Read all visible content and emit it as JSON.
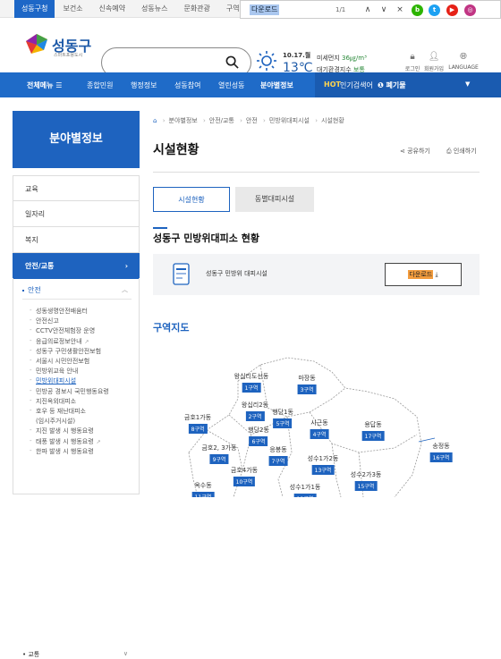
{
  "topbar": {
    "tabs": [
      "성동구청",
      "보건소",
      "신속예약",
      "성동뉴스",
      "문화관광",
      "구역"
    ],
    "find": {
      "query": "다운로드",
      "count": "1/1",
      "up": "∧",
      "down": "∨",
      "close": "×"
    },
    "sns": [
      {
        "label": "b",
        "color": "#2db400"
      },
      {
        "label": "t",
        "color": "#1da1f2"
      },
      {
        "label": "▶",
        "color": "#e62117"
      },
      {
        "label": "◎",
        "color": "#c13584"
      }
    ]
  },
  "header": {
    "logo_text": "성동구",
    "logo_sub": "스마트포용도시",
    "date": "10.17.월",
    "temp": "13℃",
    "air1_label": "미세먼지",
    "air1_value": "36㎍/m³",
    "air2_label": "대기환경지수",
    "air2_value": "보통",
    "utils": [
      {
        "icon": "lock-icon",
        "label": "로그인"
      },
      {
        "icon": "user-icon",
        "label": "회원가입"
      },
      {
        "icon": "globe-icon",
        "label": "LANGUAGE"
      }
    ]
  },
  "nav": {
    "items": [
      "전체메뉴 ☰",
      "종합민원",
      "행정정보",
      "성동참여",
      "열린성동",
      "분야별정보"
    ],
    "hot_label": "HOT",
    "hot_text": "인기검색어",
    "hot_item": "❶ 폐기물",
    "hot_arrow": "▼"
  },
  "left": {
    "title": "분야별정보",
    "menus": [
      "교육",
      "일자리",
      "복지",
      "안전/교통"
    ],
    "menu_arrow": "›",
    "sub_title": "안전",
    "sub_up": "︿",
    "sub_items": [
      {
        "label": "성동생명안전배움터",
        "ext": ""
      },
      {
        "label": "안전신고",
        "ext": ""
      },
      {
        "label": "CCTV안전체험장 운영",
        "ext": ""
      },
      {
        "label": "응급의료정보안내",
        "ext": "↗"
      },
      {
        "label": "성동구 구민생활안전보험",
        "ext": ""
      },
      {
        "label": "서울시 시민안전보험",
        "ext": ""
      },
      {
        "label": "민방위교육 안내",
        "ext": ""
      },
      {
        "label": "민방위대피시설",
        "ext": ""
      },
      {
        "label": "민방공 경보시 국민행동요령",
        "ext": ""
      },
      {
        "label": "지진옥외대피소",
        "ext": ""
      },
      {
        "label": "호우 등 재난대피소",
        "ext": ""
      },
      {
        "label": "(임시주거시설)",
        "ext": ""
      },
      {
        "label": "지진 발생 시 행동요령",
        "ext": ""
      },
      {
        "label": "태풍 발생 시 행동요령",
        "ext": "↗"
      },
      {
        "label": "한파 발생 시 행동요령",
        "ext": ""
      }
    ],
    "bottom": "교통",
    "bottom_icon": "∨"
  },
  "main": {
    "breadcrumb": [
      "⌂",
      "분야별정보",
      "안전/교통",
      "안전",
      "민방위대피시설",
      "시설현황"
    ],
    "title": "시설현황",
    "share": "공유하기",
    "print": "인쇄하기",
    "tabs": [
      "시설현황",
      "동별대피시설"
    ],
    "section_title": "성동구 민방위대피소 현황",
    "file_name": "성동구 민방위 대피시설",
    "download": "다운로드",
    "download_icon": "⤓",
    "map_title": "구역지도",
    "districts": [
      {
        "name": "왕십리도선동",
        "count": "1구역"
      },
      {
        "name": "마장동",
        "count": "3구역"
      },
      {
        "name": "왕십리2동",
        "count": "2구역"
      },
      {
        "name": "행당1동",
        "count": "5구역"
      },
      {
        "name": "금호1가동",
        "count": "8구역"
      },
      {
        "name": "사근동",
        "count": "4구역"
      },
      {
        "name": "용답동",
        "count": "17구역"
      },
      {
        "name": "행당2동",
        "count": "6구역"
      },
      {
        "name": "금호2, 3가동",
        "count": "9구역"
      },
      {
        "name": "응봉동",
        "count": "7구역"
      },
      {
        "name": "송정동",
        "count": "16구역"
      },
      {
        "name": "성수1가2동",
        "count": "13구역"
      },
      {
        "name": "금호4가동",
        "count": "10구역"
      },
      {
        "name": "옥수동",
        "count": "11구역"
      },
      {
        "name": "성수1가1동",
        "count": "12구역"
      },
      {
        "name": "성수2가3동",
        "count": "15구역"
      }
    ]
  }
}
